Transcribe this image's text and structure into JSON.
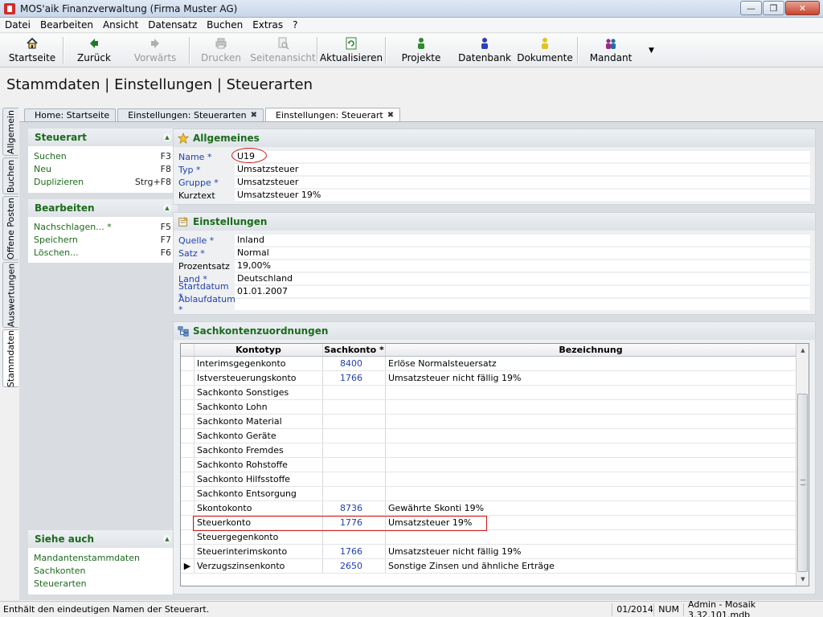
{
  "window": {
    "title": "MOS'aik Finanzverwaltung (Firma Muster AG)"
  },
  "menu": [
    "Datei",
    "Bearbeiten",
    "Ansicht",
    "Datensatz",
    "Buchen",
    "Extras",
    "?"
  ],
  "toolbar": {
    "startseite": "Startseite",
    "zurueck": "Zurück",
    "vorwaerts": "Vorwärts",
    "drucken": "Drucken",
    "seitenansicht": "Seitenansicht",
    "aktualisieren": "Aktualisieren",
    "projekte": "Projekte",
    "datenbank": "Datenbank",
    "dokumente": "Dokumente",
    "mandant": "Mandant"
  },
  "page_title": "Stammdaten | Einstellungen | Steuerarten",
  "vertical_tabs": [
    "Allgemein",
    "Buchen",
    "Offene Posten",
    "Auswertungen",
    "Stammdaten"
  ],
  "doc_tabs": [
    "Home: Startseite",
    "Einstellungen: Steuerarten",
    "Einstellungen: Steuerart"
  ],
  "sidebar": {
    "steuerart": {
      "title": "Steuerart",
      "items": [
        {
          "label": "Suchen",
          "key": "F3"
        },
        {
          "label": "Neu",
          "key": "F8"
        },
        {
          "label": "Duplizieren",
          "key": "Strg+F8"
        }
      ]
    },
    "bearbeiten": {
      "title": "Bearbeiten",
      "items": [
        {
          "label": "Nachschlagen... *",
          "key": "F5"
        },
        {
          "label": "Speichern",
          "key": "F7"
        },
        {
          "label": "Löschen...",
          "key": "F6"
        }
      ]
    },
    "siehe_auch": {
      "title": "Siehe auch",
      "items": [
        "Mandantenstammdaten",
        "Sachkonten",
        "Steuerarten"
      ]
    }
  },
  "allgemeines": {
    "title": "Allgemeines",
    "fields": [
      {
        "label": "Name *",
        "value": "U19"
      },
      {
        "label": "Typ *",
        "value": "Umsatzsteuer"
      },
      {
        "label": "Gruppe *",
        "value": "Umsatzsteuer"
      },
      {
        "label": "Kurztext",
        "value": "Umsatzsteuer 19%"
      }
    ]
  },
  "einstellungen": {
    "title": "Einstellungen",
    "fields": [
      {
        "label": "Quelle *",
        "value": "Inland"
      },
      {
        "label": "Satz *",
        "value": "Normal"
      },
      {
        "label": "Prozentsatz",
        "value": "19,00%"
      },
      {
        "label": "Land *",
        "value": "Deutschland"
      },
      {
        "label": "Startdatum *",
        "value": "01.01.2007"
      },
      {
        "label": "Ablaufdatum *",
        "value": ""
      }
    ]
  },
  "sachkonten": {
    "title": "Sachkontenzuordnungen",
    "columns": [
      "Kontotyp",
      "Sachkonto *",
      "Bezeichnung"
    ],
    "rows": [
      [
        "Interimsgegenkonto",
        "8400",
        "Erlöse Normalsteuersatz"
      ],
      [
        "Istversteuerungskonto",
        "1766",
        "Umsatzsteuer nicht fällig 19%"
      ],
      [
        "Sachkonto Sonstiges",
        "",
        ""
      ],
      [
        "Sachkonto Lohn",
        "",
        ""
      ],
      [
        "Sachkonto Material",
        "",
        ""
      ],
      [
        "Sachkonto Geräte",
        "",
        ""
      ],
      [
        "Sachkonto Fremdes",
        "",
        ""
      ],
      [
        "Sachkonto Rohstoffe",
        "",
        ""
      ],
      [
        "Sachkonto Hilfsstoffe",
        "",
        ""
      ],
      [
        "Sachkonto Entsorgung",
        "",
        ""
      ],
      [
        "Skontokonto",
        "8736",
        "Gewährte Skonti 19%"
      ],
      [
        "Steuerkonto",
        "1776",
        "Umsatzsteuer 19%"
      ],
      [
        "Steuergegenkonto",
        "",
        ""
      ],
      [
        "Steuerinterimskonto",
        "1766",
        "Umsatzsteuer nicht fällig 19%"
      ],
      [
        "Verzugszinsenkonto",
        "2650",
        "Sonstige Zinsen und ähnliche Erträge"
      ]
    ]
  },
  "status": {
    "message": "Enthält den eindeutigen Namen der Steuerart.",
    "period": "01/2014",
    "num": "NUM",
    "user": "Admin - Mosaik 3.32.101.mdb"
  }
}
